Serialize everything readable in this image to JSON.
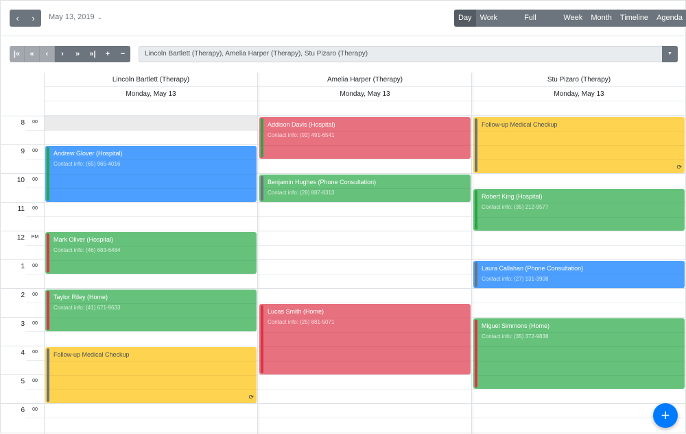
{
  "header": {
    "prev_icon": "‹",
    "next_icon": "›",
    "date_label": "May 13, 2019",
    "date_chevron": "⌄",
    "views": [
      "Day",
      "Work Week",
      "Full Week",
      "Week",
      "Month",
      "Timeline",
      "Agenda"
    ],
    "active_view": "Day"
  },
  "resource_toolbar": {
    "buttons": [
      {
        "name": "first-resource-icon",
        "glyph": "|«",
        "disabled": true
      },
      {
        "name": "prev-page-icon",
        "glyph": "«",
        "disabled": true
      },
      {
        "name": "prev-resource-icon",
        "glyph": "‹",
        "disabled": true
      },
      {
        "name": "next-resource-icon",
        "glyph": "›",
        "disabled": false
      },
      {
        "name": "next-page-icon",
        "glyph": "»",
        "disabled": false
      },
      {
        "name": "last-resource-icon",
        "glyph": "»|",
        "disabled": false
      },
      {
        "name": "add-resource-icon",
        "glyph": "+",
        "disabled": false
      },
      {
        "name": "remove-resource-icon",
        "glyph": "−",
        "disabled": false
      }
    ],
    "selected_resources": "Lincoln Bartlett (Therapy), Amelia Harper (Therapy), Stu Pizaro (Therapy)",
    "caret": "▼"
  },
  "columns": [
    {
      "resource": "Lincoln Bartlett (Therapy)",
      "date": "Monday, May 13"
    },
    {
      "resource": "Amelia Harper (Therapy)",
      "date": "Monday, May 13"
    },
    {
      "resource": "Stu Pizaro (Therapy)",
      "date": "Monday, May 13"
    }
  ],
  "hours": [
    {
      "h": "8",
      "m": "00"
    },
    {
      "h": "9",
      "m": "00"
    },
    {
      "h": "10",
      "m": "00"
    },
    {
      "h": "11",
      "m": "00"
    },
    {
      "h": "12",
      "m": "PM"
    },
    {
      "h": "1",
      "m": "00"
    },
    {
      "h": "2",
      "m": "00"
    },
    {
      "h": "3",
      "m": "00"
    },
    {
      "h": "4",
      "m": "00"
    },
    {
      "h": "5",
      "m": "00"
    },
    {
      "h": "6",
      "m": "00"
    }
  ],
  "events": [
    {
      "col": 0,
      "start": 9,
      "end": 11,
      "title": "Andrew Glover (Hospital)",
      "contact": "Contact info: (65) 965-4016",
      "bg": "#4c9ffe",
      "bar": "#28a745",
      "recurring": false
    },
    {
      "col": 0,
      "start": 12,
      "end": 13.5,
      "title": "Mark Oliver (Hospital)",
      "contact": "Contact info: (46) 683-6484",
      "bg": "#66c17b",
      "bar": "#dc3545",
      "recurring": false
    },
    {
      "col": 0,
      "start": 14,
      "end": 15.5,
      "title": "Taylor Riley (Home)",
      "contact": "Contact info: (41) 671-9633",
      "bg": "#66c17b",
      "bar": "#dc3545",
      "recurring": false
    },
    {
      "col": 0,
      "start": 16,
      "end": 18,
      "title": "Follow-up Medical Checkup",
      "contact": "",
      "bg": "#fed350",
      "bar": "#6c757d",
      "recurring": true
    },
    {
      "col": 1,
      "start": 8,
      "end": 9.5,
      "title": "Addison Davis (Hospital)",
      "contact": "Contact info: (92) 491-6541",
      "bg": "#e8717f",
      "bar": "#28a745",
      "recurring": false
    },
    {
      "col": 1,
      "start": 10,
      "end": 11,
      "title": "Benjamin Hughes (Phone Consultation)",
      "contact": "Contact info: (28) 887-8313",
      "bg": "#66c17b",
      "bar": "#6c757d",
      "recurring": false
    },
    {
      "col": 1,
      "start": 14.5,
      "end": 17,
      "title": "Lucas Smith (Home)",
      "contact": "Contact info: (25) 881-5071",
      "bg": "#e8717f",
      "bar": "#dc3545",
      "recurring": false
    },
    {
      "col": 2,
      "start": 8,
      "end": 10,
      "title": "Follow-up Medical Checkup",
      "contact": "",
      "bg": "#fed350",
      "bar": "#6c757d",
      "recurring": true
    },
    {
      "col": 2,
      "start": 10.5,
      "end": 12,
      "title": "Robert King (Hospital)",
      "contact": "Contact info: (35) 212-9577",
      "bg": "#66c17b",
      "bar": "#28a745",
      "recurring": false
    },
    {
      "col": 2,
      "start": 13,
      "end": 14,
      "title": "Laura Callahan (Phone Consultation)",
      "contact": "Contact info: (27) 131-3908",
      "bg": "#4c9ffe",
      "bar": "#6c757d",
      "recurring": false
    },
    {
      "col": 2,
      "start": 15,
      "end": 17.5,
      "title": "Miguel Simmons (Home)",
      "contact": "Contact info: (35) 372-9838",
      "bg": "#66c17b",
      "bar": "#dc3545",
      "recurring": false
    }
  ],
  "recurring_icon": "⟳",
  "fab_label": "+",
  "colors": {
    "primary": "#007bff",
    "toolbar": "#6c757d",
    "active": "#545b62"
  }
}
